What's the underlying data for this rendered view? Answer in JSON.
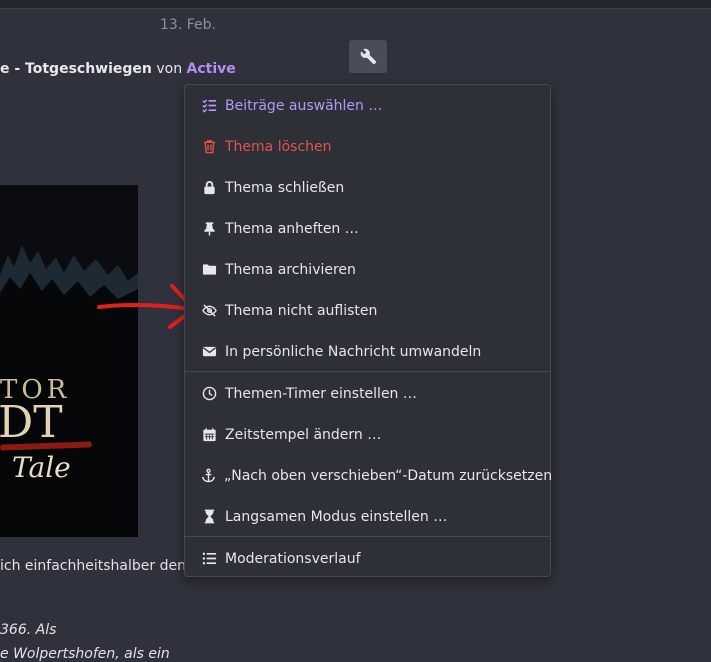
{
  "post": {
    "date": "13. Feb.",
    "title_part": "e - Totgeschwiegen",
    "by": " von ",
    "user": "Active",
    "poster_line1": "TOR",
    "poster_line2": "DT",
    "poster_line3": "Tale",
    "body_text": "ich einfachheitshalber den",
    "italic_line1": "366. Als",
    "italic_line2": "e Wolpertshofen, als ein"
  },
  "menu": {
    "items": [
      {
        "label": "Beiträge auswählen …",
        "icon": "list-check-icon"
      },
      {
        "label": "Thema löschen",
        "icon": "trash-icon"
      },
      {
        "label": "Thema schließen",
        "icon": "lock-icon"
      },
      {
        "label": "Thema anheften …",
        "icon": "thumbtack-icon"
      },
      {
        "label": "Thema archivieren",
        "icon": "folder-icon"
      },
      {
        "label": "Thema nicht auflisten",
        "icon": "eye-slash-icon"
      },
      {
        "label": "In persönliche Nachricht umwandeln",
        "icon": "envelope-icon"
      },
      {
        "label": "Themen-Timer einstellen …",
        "icon": "clock-icon"
      },
      {
        "label": "Zeitstempel ändern …",
        "icon": "calendar-icon"
      },
      {
        "label": "„Nach oben verschieben“-Datum zurücksetzen",
        "icon": "anchor-icon"
      },
      {
        "label": "Langsamen Modus einstellen …",
        "icon": "hourglass-icon"
      },
      {
        "label": "Moderationsverlauf",
        "icon": "list-icon"
      }
    ]
  },
  "colors": {
    "accent_purple": "#b896f5",
    "danger_red": "#e2534e",
    "annotation_arrow": "#e0201c"
  }
}
